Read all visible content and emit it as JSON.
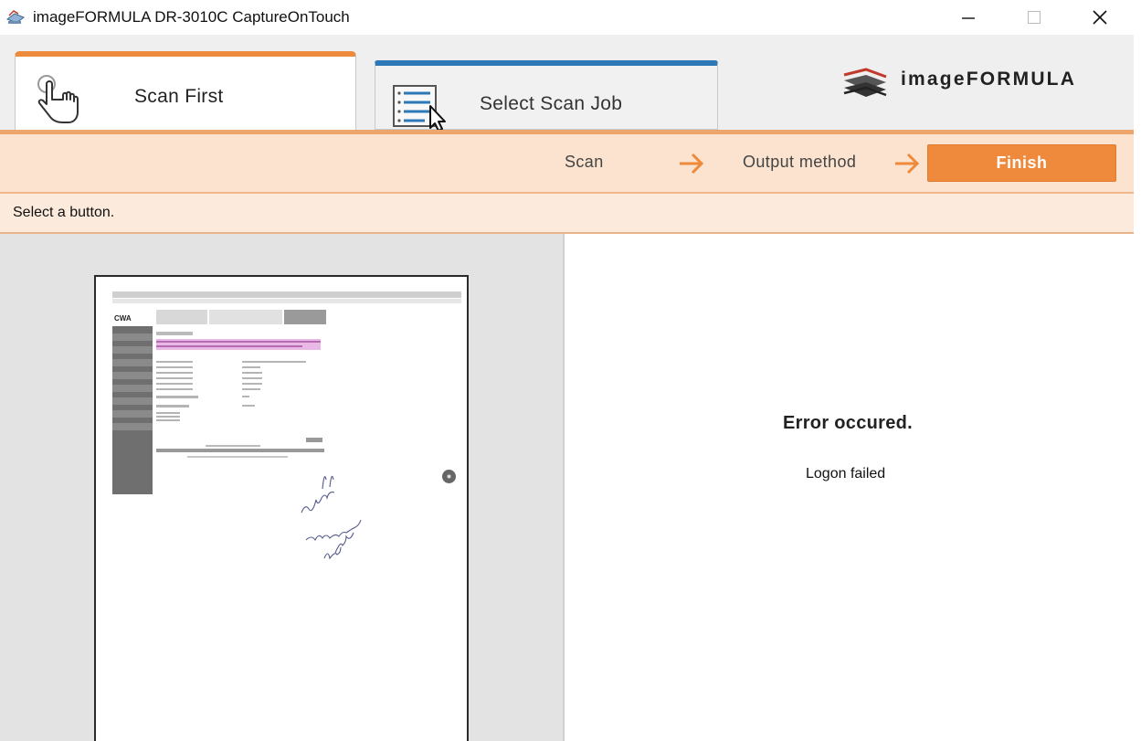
{
  "window": {
    "title": "imageFORMULA DR-3010C CaptureOnTouch",
    "icon": "scanner-app-icon",
    "controls": [
      "minimize",
      "maximize",
      "close"
    ]
  },
  "tabs": {
    "active": {
      "label": "Scan First",
      "icon": "hand-pointer-icon",
      "accent": "#ee8a3c"
    },
    "inactive": {
      "label": "Select Scan Job",
      "icon": "list-cursor-icon",
      "accent": "#2d79b8"
    }
  },
  "brand": {
    "name": "imageFORMULA"
  },
  "steps": {
    "scan": "Scan",
    "output": "Output method",
    "finish": "Finish",
    "finish_color": "#ef8a3d"
  },
  "status": {
    "text": "Select a button."
  },
  "result": {
    "title": "Error occured.",
    "detail": "Logon failed"
  },
  "preview": {
    "annotation": "please pull endorsement for file"
  }
}
